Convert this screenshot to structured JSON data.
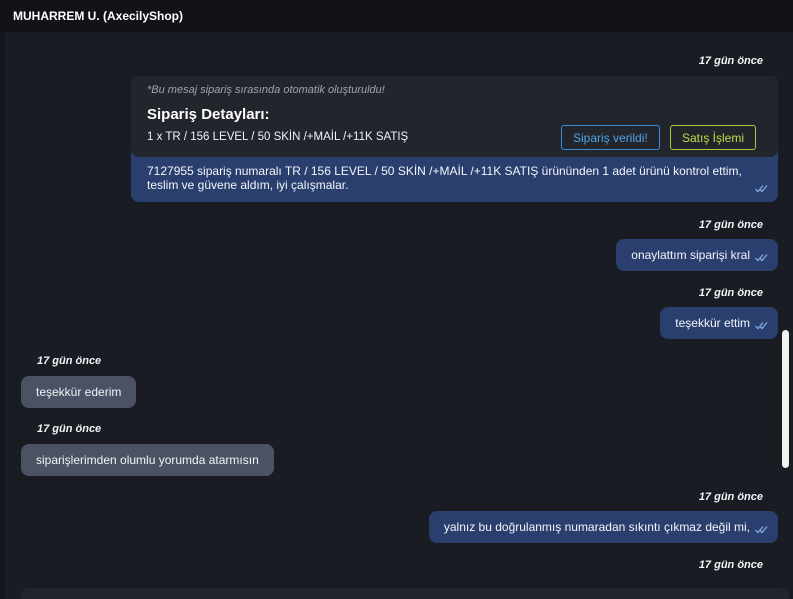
{
  "header": {
    "title": "MUHARREM U. (AxecilyShop)"
  },
  "order_card": {
    "timestamp": "17 gün önce",
    "note": "*Bu mesaj sipariş sırasında otomatik oluşturuldu!",
    "title": "Sipariş Detayları:",
    "line": "1 x TR / 156 LEVEL / 50 SKİN /+MAİL /+11K SATIŞ",
    "btn_placed": "Sipariş verildi!",
    "btn_sale": "Satış İşlemi",
    "message": "7127955 sipariş numaralı TR / 156 LEVEL / 50 SKİN /+MAİL /+11K SATIŞ ürününden 1 adet ürünü kontrol ettim, teslim ve güvene aldım, iyi çalışmalar."
  },
  "messages": [
    {
      "timestamp": "17 gün önce",
      "text": "onaylattım siparişi kral"
    },
    {
      "timestamp": "17 gün önce",
      "text": "teşekkür ettim"
    },
    {
      "timestamp": "17 gün önce",
      "text": "teşekkür ederim"
    },
    {
      "timestamp": "17 gün önce",
      "text": "siparişlerimden olumlu yorumda atarmısın"
    },
    {
      "timestamp": "17 gün önce",
      "text": "yalnız bu doğrulanmış numaradan sıkıntı çıkmaz değil mi,"
    },
    {
      "timestamp": "17 gün önce"
    }
  ],
  "icons": {
    "read_receipt": "double-check-icon"
  },
  "colors": {
    "outgoing_bubble": "#2a3f6e",
    "incoming_bubble": "#4a5264",
    "button_blue": "#3a8fd8",
    "button_green": "#a6d13a"
  }
}
